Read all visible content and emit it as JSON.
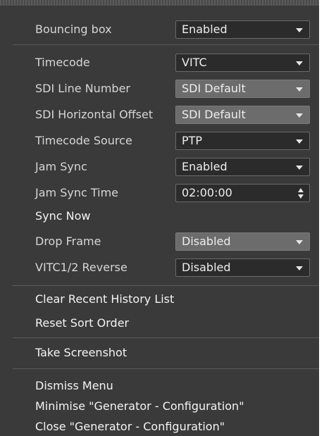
{
  "settings": {
    "bouncing_box": {
      "label": "Bouncing box",
      "value": "Enabled"
    },
    "timecode": {
      "label": "Timecode",
      "value": "VITC"
    },
    "sdi_line_number": {
      "label": "SDI Line Number",
      "value": "SDI Default"
    },
    "sdi_horizontal_offset": {
      "label": "SDI Horizontal Offset",
      "value": "SDI Default"
    },
    "timecode_source": {
      "label": "Timecode Source",
      "value": "PTP"
    },
    "jam_sync": {
      "label": "Jam Sync",
      "value": "Enabled"
    },
    "jam_sync_time": {
      "label": "Jam Sync Time",
      "value": "02:00:00"
    },
    "sync_now": {
      "label": "Sync Now"
    },
    "drop_frame": {
      "label": "Drop Frame",
      "value": "Disabled"
    },
    "vitc_reverse": {
      "label": "VITC1/2 Reverse",
      "value": "Disabled"
    }
  },
  "actions": {
    "clear_history": "Clear Recent History List",
    "reset_sort": "Reset Sort Order",
    "take_screenshot": "Take Screenshot",
    "dismiss_menu": "Dismiss Menu",
    "minimise": "Minimise \"Generator - Configuration\"",
    "close": "Close \"Generator - Configuration\""
  },
  "icons": {
    "dropdown": "chevron-down-icon",
    "spinner": "spinner-arrows-icon"
  },
  "colors": {
    "menu_bg": "#3a3a3a",
    "field_bg": "#2b2b2b",
    "highlight_bg": "#6c6c6c",
    "text": "#ececec"
  }
}
